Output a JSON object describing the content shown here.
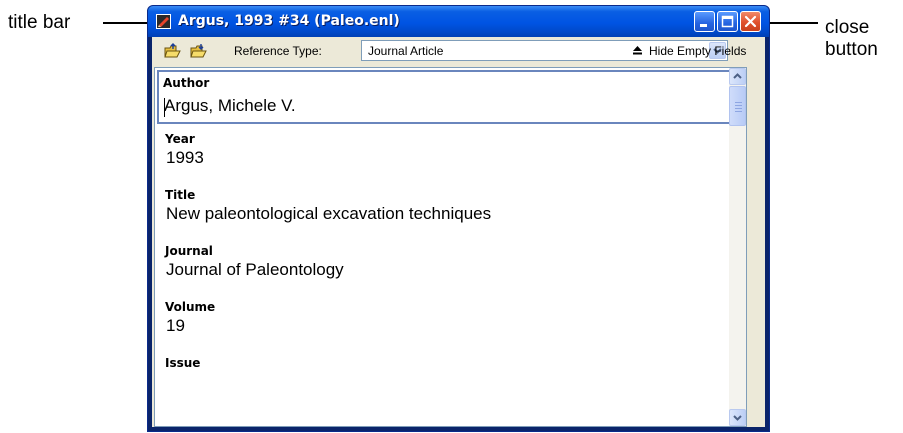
{
  "callouts": {
    "title_bar": "title bar",
    "close_button_line1": "close",
    "close_button_line2": "button"
  },
  "window": {
    "title": "Argus, 1993 #34 (Paleo.enl)",
    "controls": [
      "minimize-icon",
      "maximize-icon",
      "close-icon"
    ],
    "title_color": "#0054e3",
    "close_color": "#e0502c"
  },
  "toolbar": {
    "icons": [
      "open-folder-icon",
      "open-folder-icon"
    ],
    "reference_type_label": "Reference Type:",
    "reference_type_value": "Journal Article",
    "hide_empty_fields": "Hide Empty Fields"
  },
  "fields": [
    {
      "label": "Author",
      "value": "Argus, Michele V."
    },
    {
      "label": "Year",
      "value": "1993"
    },
    {
      "label": "Title",
      "value": "New paleontological excavation techniques"
    },
    {
      "label": "Journal",
      "value": "Journal of Paleontology"
    },
    {
      "label": "Volume",
      "value": "19"
    },
    {
      "label": "Issue",
      "value": ""
    }
  ]
}
